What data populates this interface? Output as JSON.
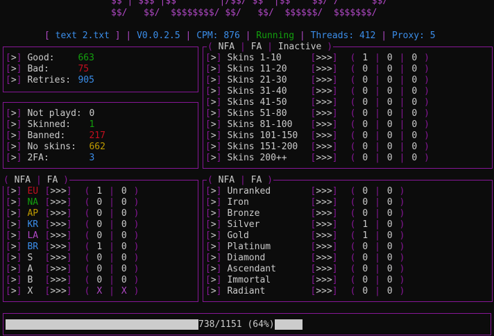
{
  "banner": {
    "line1": "$$ | $$$ |$$        |/$$/ $$  |$$    $$/ /      $$/",
    "line2": "$$/   $$/  $$$$$$$$/ $$/   $$/  $$$$$$/  $$$$$$$/"
  },
  "status": {
    "file": "text 2.txt",
    "version": "V0.0.2.5",
    "cpm_label": "CPM:",
    "cpm": "876",
    "state": "Running",
    "threads_label": "Threads:",
    "threads": "412",
    "proxy_label": "Proxy:",
    "proxy": "5"
  },
  "colors": {
    "accent": "#881798",
    "blue": "#3b8eea",
    "green": "#13a10e",
    "red": "#c50f1f",
    "yellow": "#c19c00"
  },
  "stats_top": [
    {
      "label": "Good:",
      "value": "663",
      "color": "#13a10e"
    },
    {
      "label": "Bad:",
      "value": "75",
      "color": "#c50f1f"
    },
    {
      "label": "Retries:",
      "value": "905",
      "color": "#3b8eea"
    }
  ],
  "stats_mid": [
    {
      "label": "Not playd:",
      "value": "0",
      "color": "#cccccc"
    },
    {
      "label": "Skinned:",
      "value": "1",
      "color": "#13a10e"
    },
    {
      "label": "Banned:",
      "value": "217",
      "color": "#c50f1f"
    },
    {
      "label": "No skins:",
      "value": "662",
      "color": "#c19c00"
    },
    {
      "label": "2FA:",
      "value": "3",
      "color": "#3b8eea"
    }
  ],
  "skins": {
    "legend": [
      "NFA",
      "FA",
      "Inactive"
    ],
    "rows": [
      {
        "label": "Skins 1-10",
        "v": [
          "1",
          "0",
          "0"
        ]
      },
      {
        "label": "Skins 11-20",
        "v": [
          "0",
          "0",
          "0"
        ]
      },
      {
        "label": "Skins 21-30",
        "v": [
          "0",
          "0",
          "0"
        ]
      },
      {
        "label": "Skins 31-40",
        "v": [
          "0",
          "0",
          "0"
        ]
      },
      {
        "label": "Skins 41-50",
        "v": [
          "0",
          "0",
          "0"
        ]
      },
      {
        "label": "Skins 51-80",
        "v": [
          "0",
          "0",
          "0"
        ]
      },
      {
        "label": "Skins 81-100",
        "v": [
          "0",
          "0",
          "0"
        ]
      },
      {
        "label": "Skins 101-150",
        "v": [
          "0",
          "0",
          "0"
        ]
      },
      {
        "label": "Skins 151-200",
        "v": [
          "0",
          "0",
          "0"
        ]
      },
      {
        "label": "Skins 200++",
        "v": [
          "0",
          "0",
          "0"
        ]
      }
    ]
  },
  "regions": {
    "legend": [
      "NFA",
      "FA"
    ],
    "rows": [
      {
        "label": "EU",
        "color": "#c50f1f",
        "v": [
          "1",
          "0"
        ]
      },
      {
        "label": "NA",
        "color": "#13a10e",
        "v": [
          "0",
          "0"
        ]
      },
      {
        "label": "AP",
        "color": "#c19c00",
        "v": [
          "0",
          "0"
        ]
      },
      {
        "label": "KR",
        "color": "#3b8eea",
        "v": [
          "0",
          "0"
        ]
      },
      {
        "label": "LA",
        "color": "#b148c6",
        "v": [
          "0",
          "0"
        ]
      },
      {
        "label": "BR",
        "color": "#3b8eea",
        "v": [
          "1",
          "0"
        ]
      },
      {
        "label": "S",
        "color": "#cccccc",
        "v": [
          "0",
          "0"
        ]
      },
      {
        "label": "A",
        "color": "#cccccc",
        "v": [
          "0",
          "0"
        ]
      },
      {
        "label": "B",
        "color": "#cccccc",
        "v": [
          "0",
          "0"
        ]
      },
      {
        "label": "X",
        "color": "#cccccc",
        "v": [
          "X",
          "X"
        ],
        "vcolor": "#b148c6"
      }
    ]
  },
  "ranks": {
    "legend": [
      "NFA",
      "FA"
    ],
    "rows": [
      {
        "label": "Unranked",
        "v": [
          "0",
          "0"
        ]
      },
      {
        "label": "Iron",
        "v": [
          "0",
          "0"
        ]
      },
      {
        "label": "Bronze",
        "v": [
          "0",
          "0"
        ]
      },
      {
        "label": "Silver",
        "v": [
          "1",
          "0"
        ]
      },
      {
        "label": "Gold",
        "v": [
          "1",
          "0"
        ]
      },
      {
        "label": "Platinum",
        "v": [
          "0",
          "0"
        ]
      },
      {
        "label": "Diamond",
        "v": [
          "0",
          "0"
        ]
      },
      {
        "label": "Ascendant",
        "v": [
          "0",
          "0"
        ]
      },
      {
        "label": "Immortal",
        "v": [
          "0",
          "0"
        ]
      },
      {
        "label": "Radiant",
        "v": [
          "0",
          "0"
        ]
      }
    ]
  },
  "progress": {
    "done": 738,
    "total": 1151,
    "text": "738/1151 (64%)",
    "fraction": 0.64
  }
}
